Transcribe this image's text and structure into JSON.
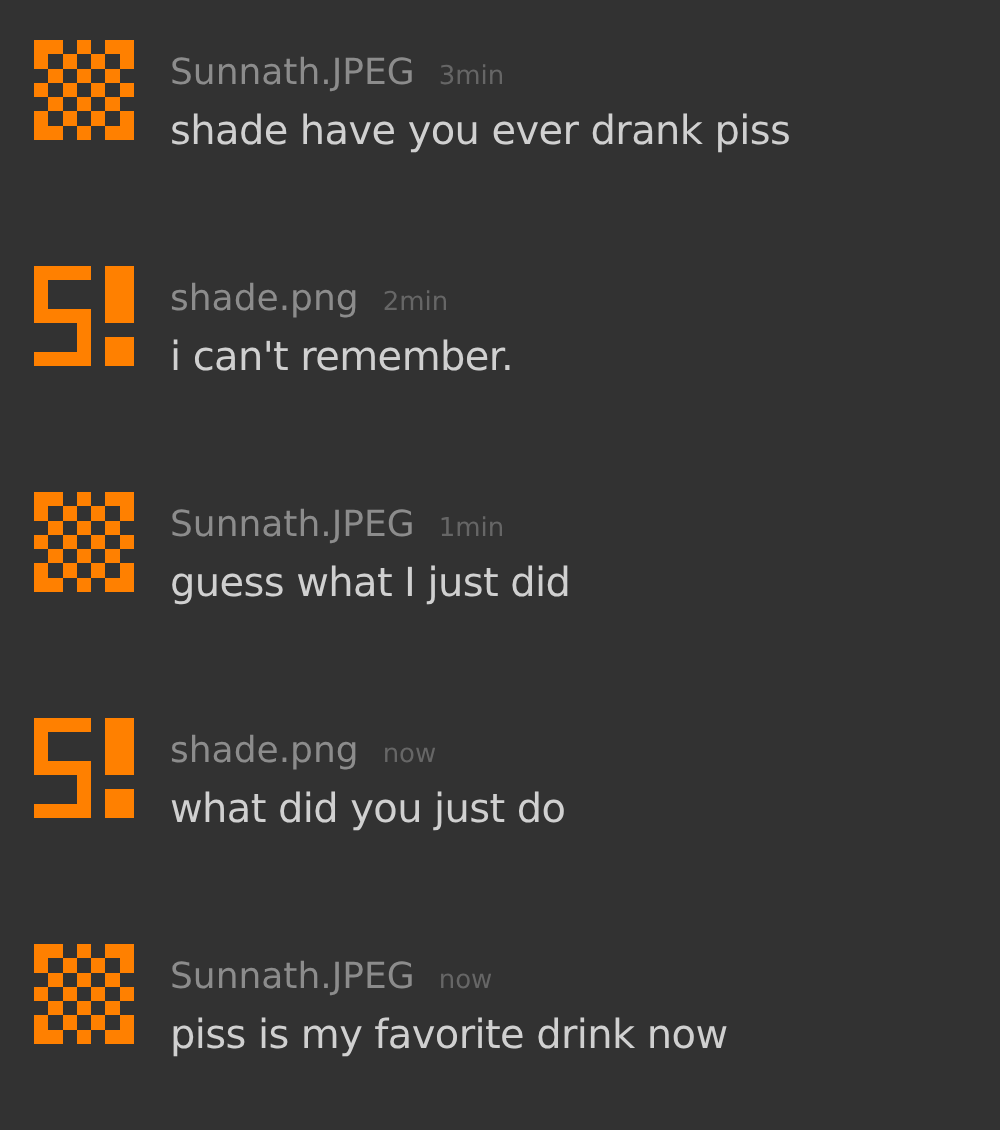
{
  "messages": [
    {
      "author": "Sunnath.JPEG",
      "kind": "checker",
      "time": "3min",
      "text": "shade have you ever drank piss"
    },
    {
      "author": "shade.png",
      "kind": "glyph",
      "time": "2min",
      "text": "i can't remember."
    },
    {
      "author": "Sunnath.JPEG",
      "kind": "checker",
      "time": "1min",
      "text": "guess what I just did"
    },
    {
      "author": "shade.png",
      "kind": "glyph",
      "time": "now",
      "text": "what did you just do"
    },
    {
      "author": "Sunnath.JPEG",
      "kind": "checker",
      "time": "now",
      "text": "piss is my favorite drink now"
    }
  ]
}
